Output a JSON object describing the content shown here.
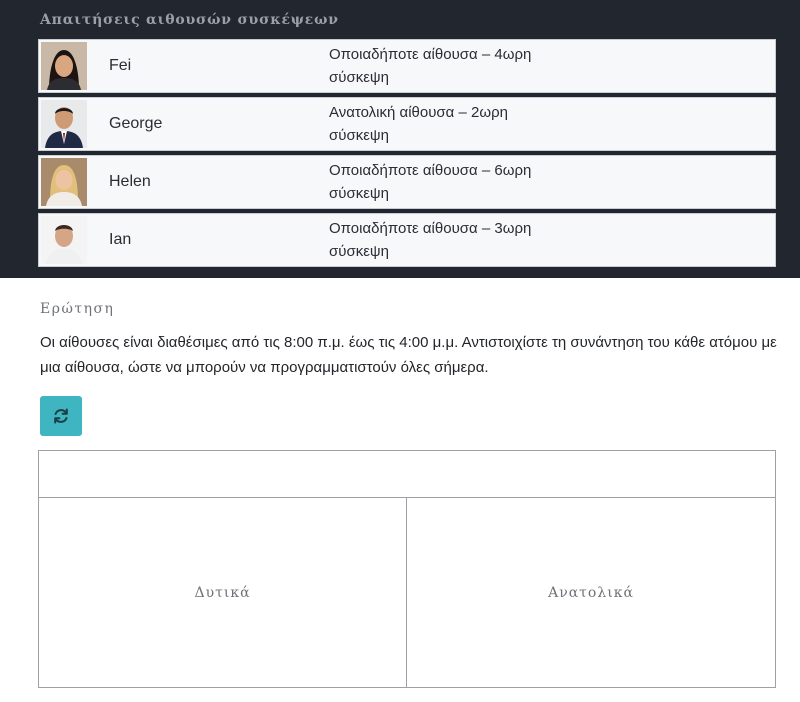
{
  "requirements": {
    "title": "Απαιτήσεις αιθουσών συσκέψεων",
    "rows": [
      {
        "name": "Fei",
        "requirement": "Οποιαδήποτε αίθουσα – 4ωρη σύσκεψη",
        "avatar": "person-photo-fei"
      },
      {
        "name": "George",
        "requirement": "Ανατολική αίθουσα – 2ωρη σύσκεψη",
        "avatar": "person-photo-george"
      },
      {
        "name": "Helen",
        "requirement": "Οποιαδήποτε αίθουσα – 6ωρη σύσκεψη",
        "avatar": "person-photo-helen"
      },
      {
        "name": "Ian",
        "requirement": "Οποιαδήποτε αίθουσα – 3ωρη σύσκεψη",
        "avatar": "person-photo-ian"
      }
    ]
  },
  "question": {
    "label": "Ερώτηση",
    "text": "Οι αίθουσες είναι διαθέσιμες από τις 8:00 π.μ. έως τις 4:00 μ.μ. Αντιστοιχίστε τη συνάντηση του κάθε ατόμου με μια αίθουσα, ώστε να μπορούν να προγραμματιστούν όλες σήμερα."
  },
  "reset_button": {
    "icon": "refresh-icon",
    "color": "#3fb5c2"
  },
  "drop_zones": {
    "west": "Δυτικά",
    "east": "Ανατολικά"
  },
  "colors": {
    "header_bg": "#22262e",
    "accent": "#3fb5c2"
  }
}
